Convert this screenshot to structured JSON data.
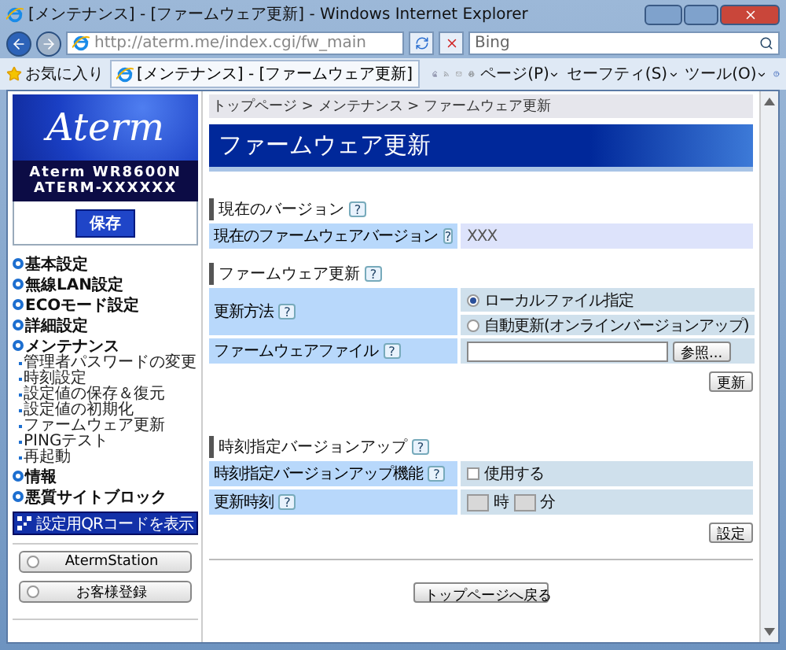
{
  "window": {
    "title": "[メンテナンス] - [ファームウェア更新] - Windows Internet Explorer"
  },
  "browser": {
    "address": "http://aterm.me/index.cgi/fw_main",
    "search_placeholder": "Bing",
    "favorites": "お気に入り",
    "tab": "[メンテナンス] - [ファームウェア更新]",
    "commands": [
      "ページ(P)",
      "セーフティ(S)",
      "ツール(O)"
    ]
  },
  "sidebar": {
    "logo": "Aterm",
    "model": "Aterm WR8600N",
    "device": "ATERM-XXXXXX",
    "save_button": "保存",
    "menu": [
      {
        "label": "基本設定"
      },
      {
        "label": "無線LAN設定"
      },
      {
        "label": "ECOモード設定"
      },
      {
        "label": "詳細設定"
      },
      {
        "label": "メンテナンス",
        "children": [
          {
            "label": "管理者パスワードの変更"
          },
          {
            "label": "時刻設定"
          },
          {
            "label": "設定値の保存＆復元"
          },
          {
            "label": "設定値の初期化"
          },
          {
            "label": "ファームウェア更新"
          },
          {
            "label": "PINGテスト"
          },
          {
            "label": "再起動"
          }
        ]
      },
      {
        "label": "情報"
      },
      {
        "label": "悪質サイトブロック"
      }
    ],
    "qr_button": "設定用QRコードを表示",
    "links": [
      "AtermStation",
      "お客様登録"
    ]
  },
  "main": {
    "breadcrumb": "トップページ > メンテナンス > ファームウェア更新",
    "title": "ファームウェア更新",
    "help": "?",
    "sections": [
      {
        "heading": "現在のバージョン",
        "rows": [
          {
            "label": "現在のファームウェアバージョン",
            "kind": "text",
            "value": "XXX"
          }
        ]
      },
      {
        "heading": "ファームウェア更新",
        "rows": [
          {
            "label": "更新方法",
            "kind": "radio",
            "options": [
              {
                "label": "ローカルファイル指定",
                "selected": true
              },
              {
                "label": "自動更新(オンラインバージョンアップ)",
                "selected": false
              }
            ]
          },
          {
            "label": "ファームウェアファイル",
            "kind": "file",
            "button": "参照..."
          }
        ],
        "action": "更新"
      },
      {
        "heading": "時刻指定バージョンアップ",
        "rows": [
          {
            "label": "時刻指定バージョンアップ機能",
            "kind": "checkbox",
            "checkbox_label": "使用する",
            "checked": false
          },
          {
            "label": "更新時刻",
            "kind": "time",
            "units": [
              "時",
              "分"
            ]
          }
        ],
        "action": "設定"
      }
    ],
    "back_button": "トップページへ戻る"
  }
}
